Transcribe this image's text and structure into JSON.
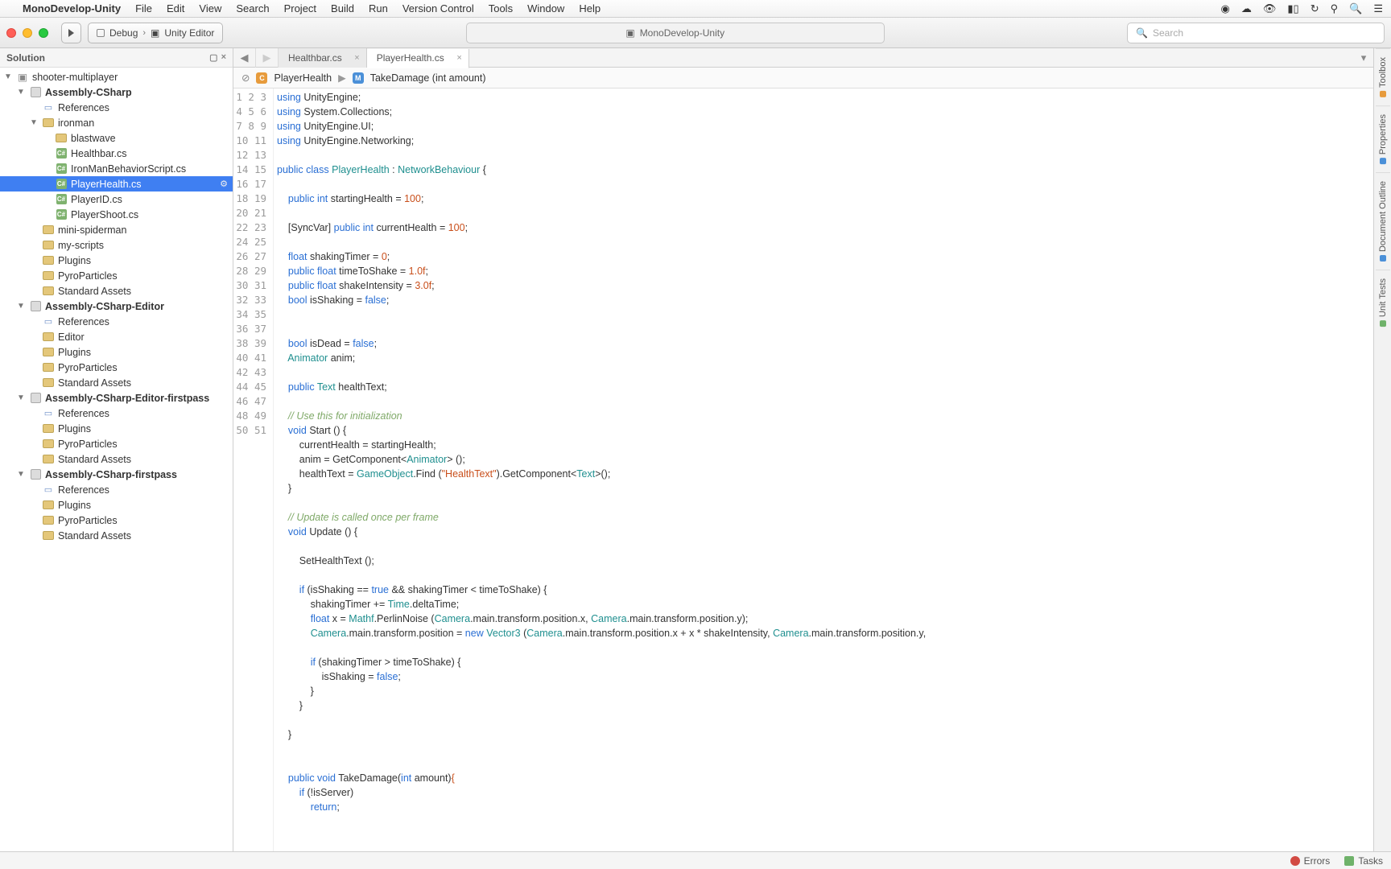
{
  "menubar": {
    "app": "MonoDevelop-Unity",
    "items": [
      "File",
      "Edit",
      "View",
      "Search",
      "Project",
      "Build",
      "Run",
      "Version Control",
      "Tools",
      "Window",
      "Help"
    ]
  },
  "toolbar": {
    "config": "Debug",
    "target": "Unity Editor",
    "title": "MonoDevelop-Unity",
    "search_placeholder": "Search"
  },
  "solution": {
    "title": "Solution",
    "root": "shooter-multiplayer",
    "projects": [
      {
        "name": "Assembly-CSharp",
        "expanded": true,
        "children": [
          {
            "name": "References",
            "type": "ref"
          },
          {
            "name": "ironman",
            "type": "folder",
            "expanded": true,
            "children": [
              {
                "name": "blastwave",
                "type": "folder"
              },
              {
                "name": "Healthbar.cs",
                "type": "cs"
              },
              {
                "name": "IronManBehaviorScript.cs",
                "type": "cs"
              },
              {
                "name": "PlayerHealth.cs",
                "type": "cs",
                "selected": true,
                "gear": true
              },
              {
                "name": "PlayerID.cs",
                "type": "cs"
              },
              {
                "name": "PlayerShoot.cs",
                "type": "cs"
              }
            ]
          },
          {
            "name": "mini-spiderman",
            "type": "folder"
          },
          {
            "name": "my-scripts",
            "type": "folder"
          },
          {
            "name": "Plugins",
            "type": "folder"
          },
          {
            "name": "PyroParticles",
            "type": "folder"
          },
          {
            "name": "Standard Assets",
            "type": "folder"
          }
        ]
      },
      {
        "name": "Assembly-CSharp-Editor",
        "expanded": true,
        "children": [
          {
            "name": "References",
            "type": "ref"
          },
          {
            "name": "Editor",
            "type": "folder"
          },
          {
            "name": "Plugins",
            "type": "folder"
          },
          {
            "name": "PyroParticles",
            "type": "folder"
          },
          {
            "name": "Standard Assets",
            "type": "folder"
          }
        ]
      },
      {
        "name": "Assembly-CSharp-Editor-firstpass",
        "expanded": true,
        "children": [
          {
            "name": "References",
            "type": "ref"
          },
          {
            "name": "Plugins",
            "type": "folder"
          },
          {
            "name": "PyroParticles",
            "type": "folder"
          },
          {
            "name": "Standard Assets",
            "type": "folder"
          }
        ]
      },
      {
        "name": "Assembly-CSharp-firstpass",
        "expanded": true,
        "children": [
          {
            "name": "References",
            "type": "ref"
          },
          {
            "name": "Plugins",
            "type": "folder"
          },
          {
            "name": "PyroParticles",
            "type": "folder"
          },
          {
            "name": "Standard Assets",
            "type": "folder"
          }
        ]
      }
    ]
  },
  "tabs": [
    {
      "label": "Healthbar.cs",
      "active": false
    },
    {
      "label": "PlayerHealth.cs",
      "active": true
    }
  ],
  "breadcrumb": {
    "class": "PlayerHealth",
    "method": "TakeDamage (int amount)"
  },
  "rpads": [
    "Toolbox",
    "Properties",
    "Document Outline",
    "Unit Tests"
  ],
  "status": {
    "errors": "Errors",
    "tasks": "Tasks"
  },
  "code": {
    "lines": [
      [
        [
          "k-blue",
          "using"
        ],
        [
          "",
          " UnityEngine;"
        ]
      ],
      [
        [
          "k-blue",
          "using"
        ],
        [
          "",
          " System.Collections;"
        ]
      ],
      [
        [
          "k-blue",
          "using"
        ],
        [
          "",
          " UnityEngine.UI;"
        ]
      ],
      [
        [
          "k-blue",
          "using"
        ],
        [
          "",
          " UnityEngine.Networking;"
        ]
      ],
      [],
      [
        [
          "k-blue",
          "public class"
        ],
        [
          "",
          " "
        ],
        [
          "k-teal",
          "PlayerHealth"
        ],
        [
          "",
          " : "
        ],
        [
          "k-teal",
          "NetworkBehaviour"
        ],
        [
          "",
          " {"
        ]
      ],
      [],
      [
        [
          "",
          "    "
        ],
        [
          "k-blue",
          "public int"
        ],
        [
          "",
          " startingHealth = "
        ],
        [
          "k-num",
          "100"
        ],
        [
          "",
          ";"
        ]
      ],
      [],
      [
        [
          "",
          "    [SyncVar] "
        ],
        [
          "k-blue",
          "public int"
        ],
        [
          "",
          " currentHealth = "
        ],
        [
          "k-num",
          "100"
        ],
        [
          "",
          ";"
        ]
      ],
      [],
      [
        [
          "",
          "    "
        ],
        [
          "k-blue",
          "float"
        ],
        [
          "",
          " shakingTimer = "
        ],
        [
          "k-num",
          "0"
        ],
        [
          "",
          ";"
        ]
      ],
      [
        [
          "",
          "    "
        ],
        [
          "k-blue",
          "public float"
        ],
        [
          "",
          " timeToShake = "
        ],
        [
          "k-num",
          "1.0f"
        ],
        [
          "",
          ";"
        ]
      ],
      [
        [
          "",
          "    "
        ],
        [
          "k-blue",
          "public float"
        ],
        [
          "",
          " shakeIntensity = "
        ],
        [
          "k-num",
          "3.0f"
        ],
        [
          "",
          ";"
        ]
      ],
      [
        [
          "",
          "    "
        ],
        [
          "k-blue",
          "bool"
        ],
        [
          "",
          " isShaking = "
        ],
        [
          "k-bool",
          "false"
        ],
        [
          "",
          ";"
        ]
      ],
      [],
      [],
      [
        [
          "",
          "    "
        ],
        [
          "k-blue",
          "bool"
        ],
        [
          "",
          " isDead = "
        ],
        [
          "k-bool",
          "false"
        ],
        [
          "",
          ";"
        ]
      ],
      [
        [
          "",
          "    "
        ],
        [
          "k-teal",
          "Animator"
        ],
        [
          "",
          " anim;"
        ]
      ],
      [],
      [
        [
          "",
          "    "
        ],
        [
          "k-blue",
          "public"
        ],
        [
          "",
          " "
        ],
        [
          "k-teal",
          "Text"
        ],
        [
          "",
          " healthText;"
        ]
      ],
      [],
      [
        [
          "",
          "    "
        ],
        [
          "k-cmt",
          "// Use this for initialization"
        ]
      ],
      [
        [
          "",
          "    "
        ],
        [
          "k-blue",
          "void"
        ],
        [
          "",
          " Start () {"
        ]
      ],
      [
        [
          "",
          "        currentHealth = startingHealth;"
        ]
      ],
      [
        [
          "",
          "        anim = GetComponent<"
        ],
        [
          "k-teal",
          "Animator"
        ],
        [
          "",
          "> ();"
        ]
      ],
      [
        [
          "",
          "        healthText = "
        ],
        [
          "k-teal",
          "GameObject"
        ],
        [
          "",
          ".Find ("
        ],
        [
          "k-str",
          "\"HealthText\""
        ],
        [
          "",
          ").GetComponent<"
        ],
        [
          "k-teal",
          "Text"
        ],
        [
          "",
          ">();"
        ]
      ],
      [
        [
          "",
          "    }"
        ]
      ],
      [],
      [
        [
          "",
          "    "
        ],
        [
          "k-cmt",
          "// Update is called once per frame"
        ]
      ],
      [
        [
          "",
          "    "
        ],
        [
          "k-blue",
          "void"
        ],
        [
          "",
          " Update () {"
        ]
      ],
      [],
      [
        [
          "",
          "        SetHealthText ();"
        ]
      ],
      [],
      [
        [
          "",
          "        "
        ],
        [
          "k-blue",
          "if"
        ],
        [
          "",
          " (isShaking == "
        ],
        [
          "k-bool",
          "true"
        ],
        [
          "",
          " && shakingTimer < timeToShake) {"
        ]
      ],
      [
        [
          "",
          "            shakingTimer += "
        ],
        [
          "k-teal",
          "Time"
        ],
        [
          "",
          ".deltaTime;"
        ]
      ],
      [
        [
          "",
          "            "
        ],
        [
          "k-blue",
          "float"
        ],
        [
          "",
          " x = "
        ],
        [
          "k-teal",
          "Mathf"
        ],
        [
          "",
          ".PerlinNoise ("
        ],
        [
          "k-teal",
          "Camera"
        ],
        [
          "",
          ".main.transform.position.x, "
        ],
        [
          "k-teal",
          "Camera"
        ],
        [
          "",
          ".main.transform.position.y);"
        ]
      ],
      [
        [
          "",
          "            "
        ],
        [
          "k-teal",
          "Camera"
        ],
        [
          "",
          ".main.transform.position = "
        ],
        [
          "k-blue",
          "new"
        ],
        [
          "",
          " "
        ],
        [
          "k-teal",
          "Vector3"
        ],
        [
          "",
          " ("
        ],
        [
          "k-teal",
          "Camera"
        ],
        [
          "",
          ".main.transform.position.x + x * shakeIntensity, "
        ],
        [
          "k-teal",
          "Camera"
        ],
        [
          "",
          ".main.transform.position.y,"
        ]
      ],
      [],
      [
        [
          "",
          "            "
        ],
        [
          "k-blue",
          "if"
        ],
        [
          "",
          " (shakingTimer > timeToShake) {"
        ]
      ],
      [
        [
          "",
          "                isShaking = "
        ],
        [
          "k-bool",
          "false"
        ],
        [
          "",
          ";"
        ]
      ],
      [
        [
          "",
          "            }"
        ]
      ],
      [
        [
          "",
          "        }"
        ]
      ],
      [],
      [
        [
          "",
          "    }"
        ]
      ],
      [],
      [],
      [
        [
          "",
          "    "
        ],
        [
          "k-blue",
          "public void"
        ],
        [
          "",
          " TakeDamage("
        ],
        [
          "k-blue",
          "int"
        ],
        [
          "",
          " amount)"
        ],
        [
          "k-num",
          "{"
        ]
      ],
      [
        [
          "",
          "        "
        ],
        [
          "k-blue",
          "if"
        ],
        [
          "",
          " (!isServer)"
        ]
      ],
      [
        [
          "",
          "            "
        ],
        [
          "k-blue",
          "return"
        ],
        [
          "",
          ";"
        ]
      ],
      []
    ]
  }
}
